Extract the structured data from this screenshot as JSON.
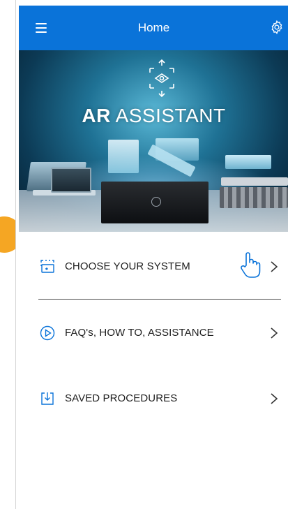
{
  "appbar": {
    "title": "Home",
    "menu_icon": "hamburger-menu-icon",
    "settings_icon": "gear-icon",
    "color": "#0a73d9"
  },
  "hero": {
    "title_bold": "AR",
    "title_light": "ASSISTANT",
    "icon": "ar-scan-icon"
  },
  "menu": {
    "items": [
      {
        "label": "CHOOSE YOUR SYSTEM",
        "icon": "select-system-icon"
      },
      {
        "label": "FAQ's, HOW TO, ASSISTANCE",
        "icon": "play-circle-icon"
      },
      {
        "label": "SAVED PROCEDURES",
        "icon": "download-box-icon"
      }
    ],
    "icon_color": "#0a73d9"
  },
  "cursor": {
    "icon": "hand-pointer-icon"
  },
  "accent": {
    "dot_color": "#f5a623"
  }
}
